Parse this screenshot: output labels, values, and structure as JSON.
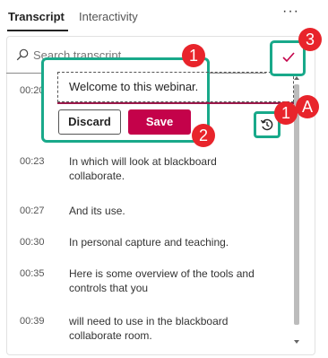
{
  "tabs": [
    {
      "label": "Transcript",
      "active": true
    },
    {
      "label": "Interactivity",
      "active": false
    }
  ],
  "more_label": "···",
  "search": {
    "placeholder": "Search transcript",
    "value": ""
  },
  "edit": {
    "time": "00:20",
    "value": "Welcome to this webinar.",
    "discard_label": "Discard",
    "save_label": "Save"
  },
  "entries": [
    {
      "time": "00:23",
      "text": "In which will look at blackboard collaborate."
    },
    {
      "time": "00:27",
      "text": "And its use."
    },
    {
      "time": "00:30",
      "text": "In personal capture and teaching."
    },
    {
      "time": "00:35",
      "text": "Here is some overview of the tools and controls that you"
    },
    {
      "time": "00:39",
      "text": "will need to use in the blackboard collaborate room."
    }
  ],
  "annotations": {
    "badge_1": "1",
    "badge_2": "2",
    "badge_3": "3",
    "badge_1a_num": "1",
    "badge_1a_letter": "A"
  },
  "icons": {
    "search": "search-icon",
    "confirm": "checkmark-icon",
    "revert": "revert-icon",
    "more": "more-icon"
  },
  "colors": {
    "accent_teal": "#19a98a",
    "save_button": "#c4024a",
    "badge_red": "#e8242b",
    "edit_underline": "#9b1a4b"
  }
}
